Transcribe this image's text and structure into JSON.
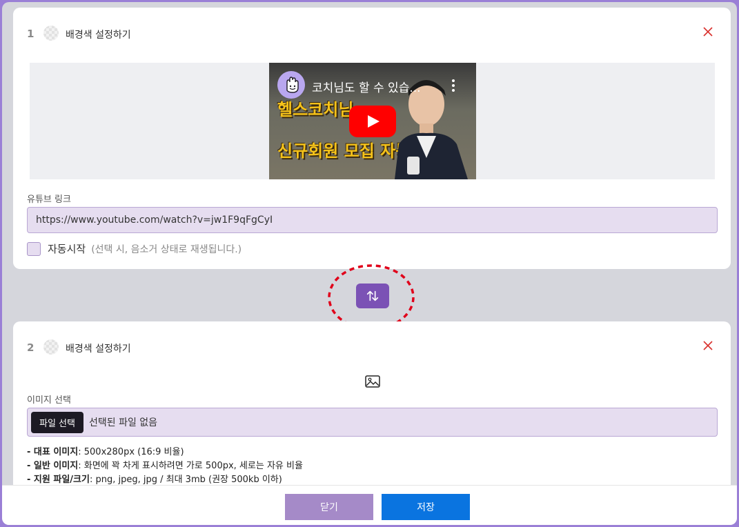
{
  "blocks": [
    {
      "number": "1",
      "title": "배경색 설정하기",
      "video": {
        "title": "코치님도 할 수 있습...",
        "thumb_line1": "헬스코치님",
        "thumb_line2": "신규회원 모집 자동화"
      },
      "link_label": "유튜브 링크",
      "link_value": "https://www.youtube.com/watch?v=jw1F9qFgCyI",
      "autoplay_label": "자동시작",
      "autoplay_hint": "(선택 시, 음소거 상태로 재생됩니다.)"
    },
    {
      "number": "2",
      "title": "배경색 설정하기",
      "image_label": "이미지 선택",
      "file_button": "파일 선택",
      "file_status": "선택된 파일 없음",
      "notes": [
        {
          "key": "- 대표 이미지",
          "value": ": 500x280px (16:9 비율)"
        },
        {
          "key": "- 일반 이미지",
          "value": ": 화면에 꽉 차게 표시하려면 가로 500px, 세로는 자유 비율"
        },
        {
          "key": "- 지원 파일/크기",
          "value": ": png, jpeg, jpg / 최대 3mb (권장 500kb 이하)"
        }
      ]
    }
  ],
  "footer": {
    "close_label": "닫기",
    "save_label": "저장"
  },
  "colors": {
    "accent": "#7b52b5",
    "input_bg": "#e6ddf0",
    "close_red": "#d9302c",
    "save_blue": "#0a74e0",
    "annotation_red": "#e0001a"
  }
}
